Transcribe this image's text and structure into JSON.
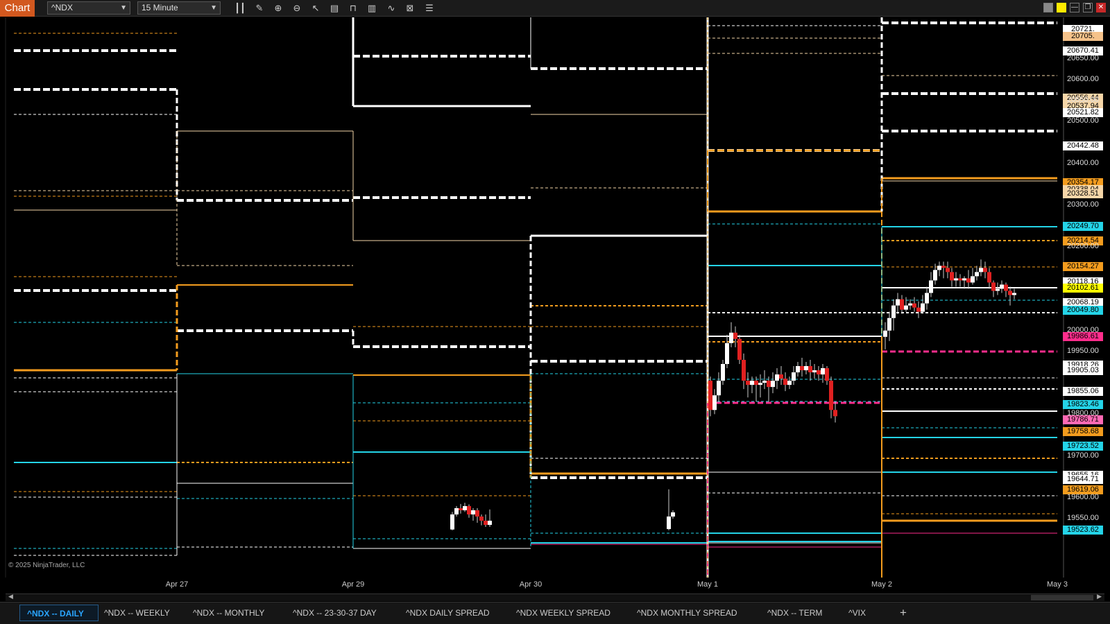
{
  "app": {
    "label": "Chart"
  },
  "toolbar": {
    "instrument": "^NDX",
    "interval": "15 Minute",
    "icons": [
      "bar-type-icon",
      "pencil-icon",
      "zoom-in-icon",
      "zoom-out-icon",
      "pointer-icon",
      "properties-icon",
      "template-icon",
      "data-box-icon",
      "strategy-icon",
      "indicator-icon",
      "list-icon"
    ]
  },
  "window": {
    "buttons": [
      "tile-icon",
      "highlight-icon",
      "minimize-icon",
      "restore-icon",
      "close-icon"
    ]
  },
  "copyright": "© 2025 NinjaTrader, LLC",
  "chart_data": {
    "type": "candlestick",
    "instrument": "^NDX",
    "interval": "15 Minute",
    "x_labels": [
      "Apr 27",
      "Apr 29",
      "Apr 30",
      "May 1",
      "May 2",
      "May 3"
    ],
    "y_range": [
      19500,
      20740
    ],
    "y_ticks": [
      "20650.00",
      "20600.00",
      "20550.00",
      "20500.00",
      "20400.00",
      "20300.00",
      "20200.00",
      "20000.00",
      "19950.00",
      "19800.00",
      "19700.00",
      "19600.00",
      "19550.00"
    ],
    "price_tags": [
      {
        "value": "20721.",
        "color": "#ffffff"
      },
      {
        "value": "20705.",
        "color": "#f5c28a"
      },
      {
        "value": "20670.41",
        "color": "#ffffff"
      },
      {
        "value": "20556.44",
        "color": "#f5d6a8"
      },
      {
        "value": "20537.94",
        "color": "#f5d6a8"
      },
      {
        "value": "20521.82",
        "color": "#ffffff"
      },
      {
        "value": "20442.48",
        "color": "#ffffff"
      },
      {
        "value": "20354.17",
        "color": "#f39c1e"
      },
      {
        "value": "20338.04",
        "color": "#f5d6a8"
      },
      {
        "value": "20328.51",
        "color": "#f5d6a8"
      },
      {
        "value": "20249.70",
        "color": "#24d4e8"
      },
      {
        "value": "20214.54",
        "color": "#f39c1e"
      },
      {
        "value": "20154.27",
        "color": "#f39c1e"
      },
      {
        "value": "20118.16",
        "color": "#ffffff"
      },
      {
        "value": "20102.61",
        "color": "#ffff00"
      },
      {
        "value": "20068.19",
        "color": "#ffffff"
      },
      {
        "value": "20049.80",
        "color": "#24d4e8"
      },
      {
        "value": "19986.61",
        "color": "#ff2d8c"
      },
      {
        "value": "19918.26",
        "color": "#ffffff"
      },
      {
        "value": "19905.03",
        "color": "#ffffff"
      },
      {
        "value": "19855.06",
        "color": "#ffffff"
      },
      {
        "value": "19823.46",
        "color": "#24d4e8"
      },
      {
        "value": "19786.71",
        "color": "#ff69b4"
      },
      {
        "value": "19758.68",
        "color": "#f39c1e"
      },
      {
        "value": "19723.52",
        "color": "#24d4e8"
      },
      {
        "value": "19655.16",
        "color": "#ffffff"
      },
      {
        "value": "19644.71",
        "color": "#ffffff"
      },
      {
        "value": "19619.06",
        "color": "#f39c1e"
      },
      {
        "value": "19523.62",
        "color": "#24d4e8"
      }
    ]
  },
  "tabs": [
    {
      "label": "^NDX -- DAILY",
      "active": true
    },
    {
      "label": "^NDX -- WEEKLY",
      "active": false
    },
    {
      "label": "^NDX -- MONTHLY",
      "active": false
    },
    {
      "label": "^NDX -- 23-30-37 DAY",
      "active": false
    },
    {
      "label": "^NDX DAILY SPREAD",
      "active": false
    },
    {
      "label": "^NDX WEEKLY SPREAD",
      "active": false
    },
    {
      "label": "^NDX MONTHLY SPREAD",
      "active": false
    },
    {
      "label": "^NDX -- TERM",
      "active": false
    },
    {
      "label": "^VIX",
      "active": false
    }
  ]
}
